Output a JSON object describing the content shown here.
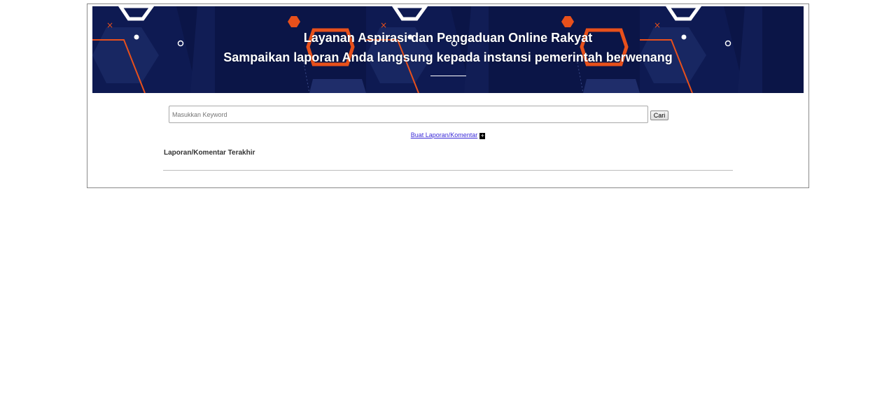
{
  "banner": {
    "title": "Layanan Aspirasi dan Pengaduan Online Rakyat",
    "subtitle": "Sampaikan laporan Anda langsung kepada instansi pemerintah berwenang",
    "colors": {
      "background": "#0b1547",
      "accent_orange": "#e8501b",
      "panel_blue": "#1c2a66",
      "text": "#ffffff"
    }
  },
  "search": {
    "placeholder": "Masukkan Keyword",
    "value": "",
    "button_label": "Cari"
  },
  "actions": {
    "create_report_label": "Buat Laporan/Komentar",
    "create_icon": "plus-icon",
    "create_icon_glyph": "+"
  },
  "reports": {
    "heading": "Laporan/Komentar Terakhir",
    "items": []
  }
}
